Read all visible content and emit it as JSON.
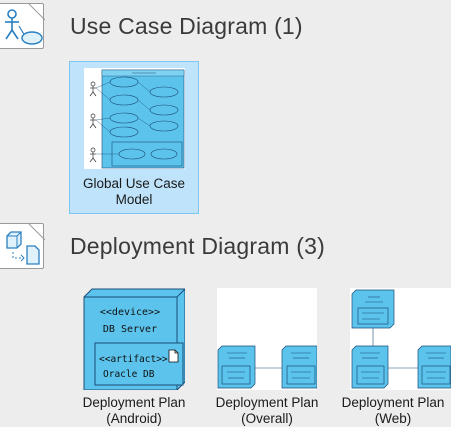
{
  "sections": [
    {
      "title": "Use Case Diagram (1)",
      "icon": "use-case-diagram-icon",
      "items": [
        {
          "label_line1": "Global Use Case",
          "label_line2": "Model",
          "selected": true
        }
      ]
    },
    {
      "title": "Deployment Diagram (3)",
      "icon": "deployment-diagram-icon",
      "items": [
        {
          "label_line1": "Deployment Plan",
          "label_line2": "(Android)",
          "device_stereotype": "<<device>>",
          "device_name": "DB Server",
          "artifact_stereotype": "<<artifact>>",
          "artifact_name": "Oracle DB"
        },
        {
          "label_line1": "Deployment Plan",
          "label_line2": "(Overall)"
        },
        {
          "label_line1": "Deployment Plan",
          "label_line2": "(Web)"
        }
      ]
    }
  ],
  "colors": {
    "accent": "#5bc3ec",
    "selection_bg": "#bfe3fa",
    "selection_border": "#7ec6f0",
    "node_border": "#1b4e78"
  }
}
